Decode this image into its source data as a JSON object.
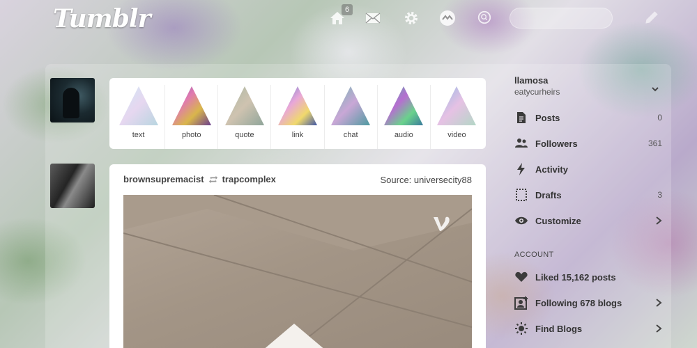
{
  "header": {
    "logo_text": "Tumblr",
    "home_badge": "6",
    "search_placeholder": ""
  },
  "post_types": [
    {
      "label": "text",
      "icon": "holo-triangle-text"
    },
    {
      "label": "photo",
      "icon": "holo-triangle-photo"
    },
    {
      "label": "quote",
      "icon": "holo-triangle-quote"
    },
    {
      "label": "link",
      "icon": "holo-triangle-link"
    },
    {
      "label": "chat",
      "icon": "holo-triangle-chat"
    },
    {
      "label": "audio",
      "icon": "holo-triangle-audio"
    },
    {
      "label": "video",
      "icon": "holo-triangle-video"
    }
  ],
  "post": {
    "author": "brownsupremacist",
    "reblogged_from": "trapcomplex",
    "source": "Source: universecity88",
    "media_icon": "vine-icon"
  },
  "sidebar": {
    "blog_name": "llamosa",
    "blog_title": "eatycurheirs",
    "items": [
      {
        "label": "Posts",
        "count": "0",
        "icon": "document-icon"
      },
      {
        "label": "Followers",
        "count": "361",
        "icon": "people-icon"
      },
      {
        "label": "Activity",
        "count": "",
        "icon": "lightning-icon"
      },
      {
        "label": "Drafts",
        "count": "3",
        "icon": "drafts-icon"
      },
      {
        "label": "Customize",
        "count": "",
        "icon": "eye-icon"
      }
    ],
    "account_label": "ACCOUNT",
    "account_items": [
      {
        "label": "Liked 15,162 posts",
        "icon": "heart-icon"
      },
      {
        "label": "Following 678 blogs",
        "icon": "following-icon"
      },
      {
        "label": "Find Blogs",
        "icon": "find-blogs-icon"
      }
    ]
  }
}
